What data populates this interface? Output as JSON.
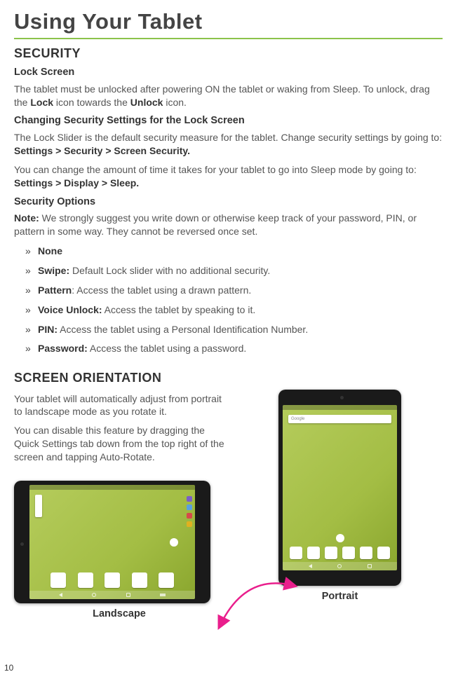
{
  "page_title": "Using Your Tablet",
  "security": {
    "heading": "SECURITY",
    "lock_screen": {
      "heading": "Lock Screen",
      "body_pre": "The tablet must be unlocked after powering ON the tablet or waking from Sleep. To unlock, drag the ",
      "lock_b": "Lock",
      "body_mid": " icon towards the ",
      "unlock_b": "Unlock",
      "body_post": " icon."
    },
    "changing": {
      "heading": "Changing Security Settings for the Lock Screen",
      "body_pre": "The Lock Slider is the default security measure for the tablet. Change security settings by going to: ",
      "path": "Settings > Security > Screen Security.",
      "sleep_pre": "You can change the amount of time it takes for your tablet to go into Sleep mode by going to: ",
      "sleep_path": "Settings > Display > Sleep."
    },
    "options": {
      "heading": "Security Options",
      "note_b": "Note:",
      "note": " We strongly suggest you write down or otherwise keep track of your password, PIN, or pattern in some way. They cannot be reversed once set.",
      "items": [
        {
          "label": "None",
          "desc": ""
        },
        {
          "label": "Swipe:",
          "desc": " Default Lock slider with no additional security."
        },
        {
          "label": "Pattern",
          "desc": ": Access the tablet using a drawn pattern."
        },
        {
          "label": "Voice Unlock:",
          "desc": " Access the tablet by speaking to it."
        },
        {
          "label": "PIN:",
          "desc": " Access the tablet using a Personal Identification Number."
        },
        {
          "label": "Password:",
          "desc": " Access the tablet using a password."
        }
      ]
    }
  },
  "orientation": {
    "heading": "SCREEN ORIENTATION",
    "p1": "Your tablet will automatically adjust from portrait to landscape mode as you rotate it.",
    "p2": "You can disable this feature by dragging the Quick Settings tab down from the top right of the screen and tapping Auto-Rotate.",
    "landscape_caption": "Landscape",
    "portrait_caption": "Portrait"
  },
  "page_number": "10",
  "colors": {
    "accent_green": "#8bc34a",
    "magenta": "#e91e8c"
  }
}
